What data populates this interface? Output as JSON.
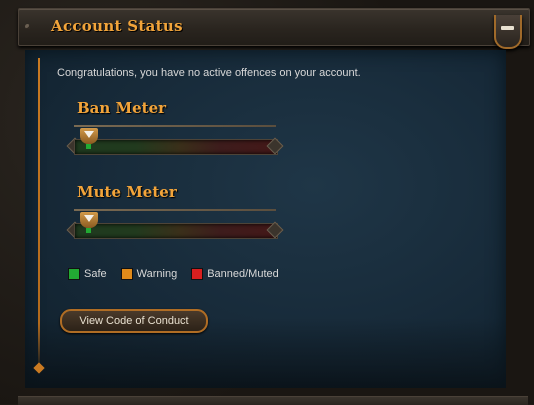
{
  "header": {
    "title": "Account Status"
  },
  "intro_text": "Congratulations, you have no active offences on your account.",
  "meters": [
    {
      "title": "Ban Meter",
      "level": 0
    },
    {
      "title": "Mute Meter",
      "level": 0
    }
  ],
  "legend": [
    {
      "label": "Safe",
      "color": "#22aa33"
    },
    {
      "label": "Warning",
      "color": "#e08a1a"
    },
    {
      "label": "Banned/Muted",
      "color": "#d81f1f"
    }
  ],
  "buttons": {
    "code_of_conduct": "View Code of Conduct"
  },
  "colors": {
    "accent": "#f2a43a",
    "frame": "#b06d24",
    "panel": "#1a2f3f"
  }
}
